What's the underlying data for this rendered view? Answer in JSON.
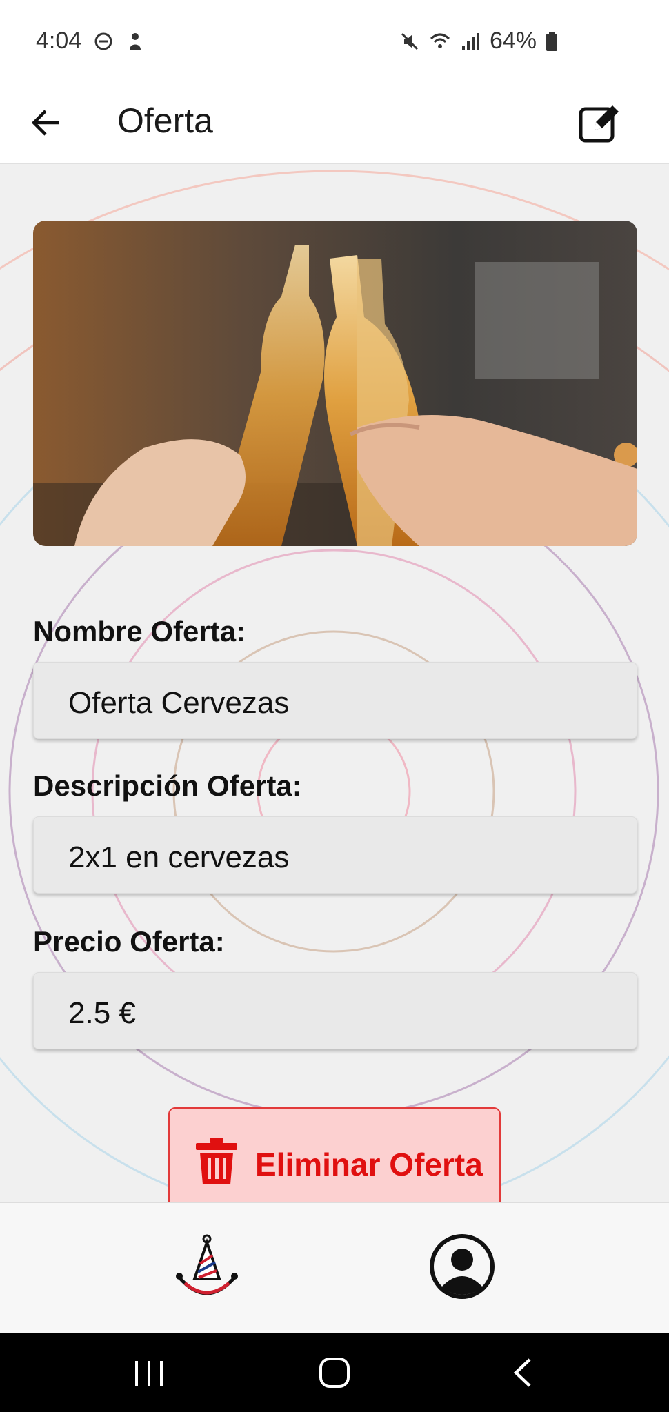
{
  "status_bar": {
    "time": "4:04",
    "battery_percent": "64%",
    "icons": [
      "do-not-disturb-icon",
      "notification-person-icon",
      "mute-icon",
      "wifi-icon",
      "signal-icon",
      "battery-icon"
    ]
  },
  "app_bar": {
    "title": "Oferta",
    "back_icon": "arrow-left-icon",
    "edit_icon": "edit-icon"
  },
  "offer": {
    "image_icon": "beer-bottles-toast-photo",
    "name_label": "Nombre Oferta:",
    "name_value": "Oferta Cervezas",
    "description_label": "Descripción Oferta:",
    "description_value": "2x1 en cervezas",
    "price_label": "Precio Oferta:",
    "price_value": "2.5 €"
  },
  "actions": {
    "delete_label": "Eliminar Oferta",
    "delete_icon": "trash-icon"
  },
  "bottom_nav": {
    "items": [
      {
        "icon": "party-logo-icon"
      },
      {
        "icon": "user-profile-icon"
      }
    ]
  },
  "colors": {
    "delete_text": "#e01010",
    "delete_bg": "#fcd0d0",
    "delete_border": "#e23a3a",
    "page_bg": "#f0f0f0"
  }
}
